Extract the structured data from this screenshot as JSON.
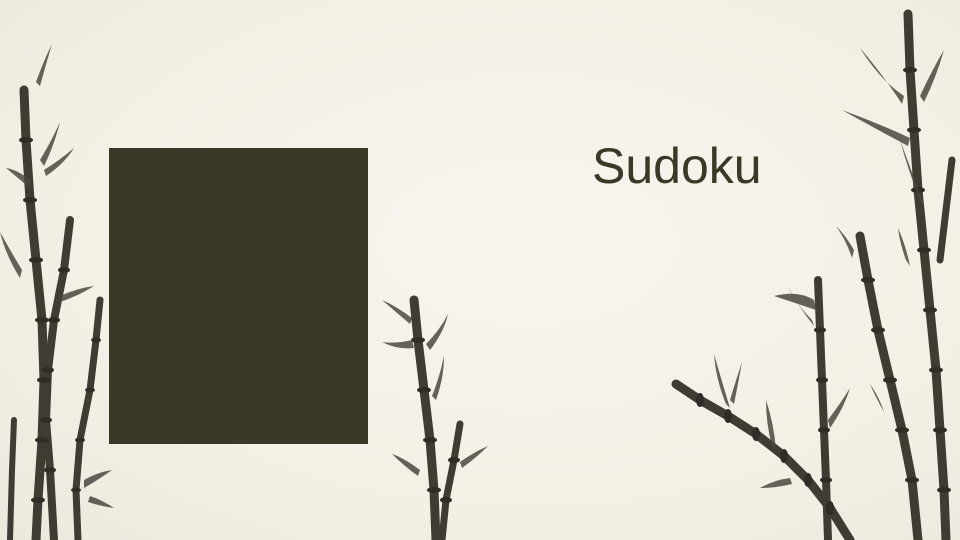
{
  "slide": {
    "title": "Sudoku",
    "background_color": "#f4f1e8",
    "ink_color": "#3b3828",
    "image_placeholder_color": "#3b3828"
  },
  "decorations": {
    "icons": [
      "bamboo-icon"
    ]
  }
}
